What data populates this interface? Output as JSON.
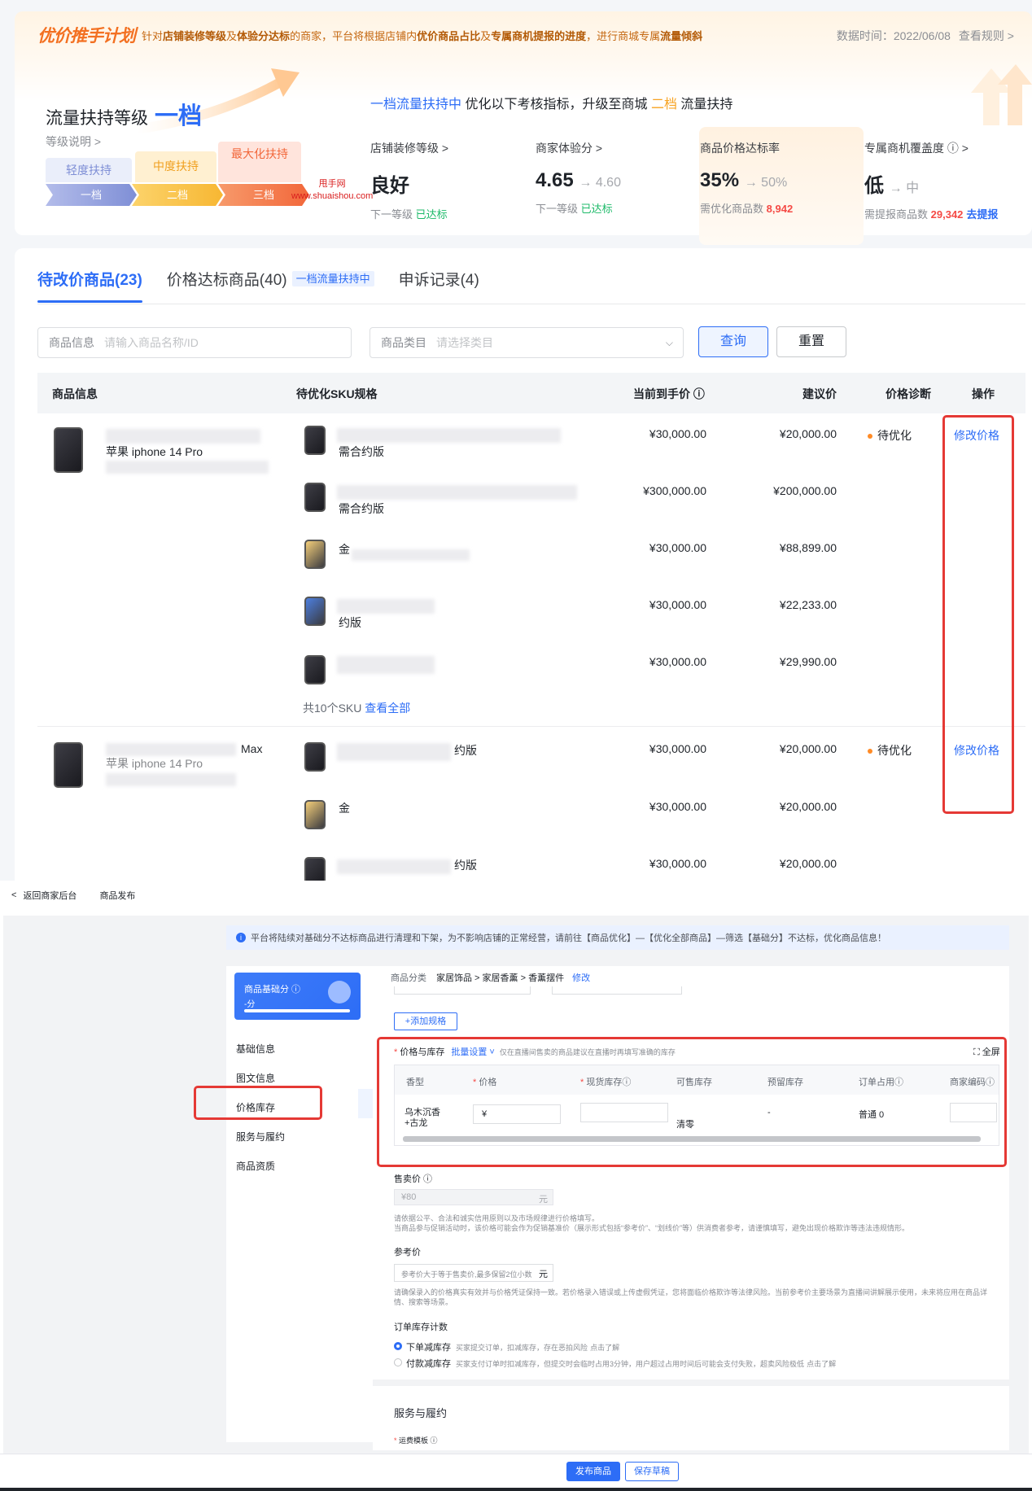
{
  "banner": {
    "logo": "优价推手计划",
    "desc_parts": [
      "针对",
      "店铺装修等级",
      "及",
      "体验分达标",
      "的商家，平台将根据店铺内",
      "优价商品占比",
      "及",
      "专属商机提报的进度",
      "，进行商城专属",
      "流量倾斜"
    ],
    "data_time": "数据时间：2022/06/08",
    "rules_link": "查看规则 >"
  },
  "level": {
    "title": "流量扶持等级",
    "current": "一档",
    "explain": "等级说明 >",
    "tiers": [
      {
        "top": "轻度扶持",
        "label": "一档",
        "color": "#7f8fd6"
      },
      {
        "top": "中度扶持",
        "label": "二档",
        "color": "#f7b733"
      },
      {
        "top": "最大化扶持",
        "label": "三档",
        "color": "#f2673a"
      }
    ],
    "watermark_line1": "甩手网",
    "watermark_line2": "www.shuaishou.com"
  },
  "upgrade": {
    "status": "一档流量扶持中",
    "text": "优化以下考核指标，升级至商城",
    "target": "二档",
    "suffix": "流量扶持"
  },
  "metrics": [
    {
      "label": "店铺装修等级 >",
      "value": "良好",
      "sub": "",
      "foot_prefix": "下一等级",
      "foot_value": "已达标",
      "foot_link": ""
    },
    {
      "label": "商家体验分 >",
      "value": "4.65",
      "sub": "→ 4.60",
      "foot_prefix": "下一等级",
      "foot_value": "已达标",
      "foot_link": ""
    },
    {
      "label": "商品价格达标率",
      "value": "35%",
      "sub": "→ 50%",
      "foot_prefix": "需优化商品数",
      "foot_value": "8,942",
      "foot_link": ""
    },
    {
      "label": "专属商机覆盖度 ⓘ >",
      "value": "低",
      "sub": "→ 中",
      "foot_prefix": "需提报商品数",
      "foot_value": "29,342",
      "foot_link": "去提报"
    }
  ],
  "tabs": [
    {
      "label": "待改价商品(23)",
      "badge": ""
    },
    {
      "label": "价格达标商品(40)",
      "badge": "一档流量扶持中"
    },
    {
      "label": "申诉记录(4)",
      "badge": ""
    }
  ],
  "filters": {
    "product_label": "商品信息",
    "product_placeholder": "请输入商品名称/ID",
    "category_label": "商品类目",
    "category_placeholder": "请选择类目",
    "query": "查询",
    "reset": "重置"
  },
  "table": {
    "headers": [
      "商品信息",
      "待优化SKU规格",
      "当前到手价 ⓘ",
      "建议价",
      "价格诊断",
      "操作"
    ],
    "products": [
      {
        "name": "苹果 iphone 14 Pro",
        "diagnosis": "待优化",
        "action": "修改价格",
        "skus": [
          {
            "spec": "需合约版",
            "current": "¥30,000.00",
            "suggest": "¥20,000.00"
          },
          {
            "spec": "需合约版",
            "current": "¥300,000.00",
            "suggest": "¥200,000.00"
          },
          {
            "spec": "金",
            "current": "¥30,000.00",
            "suggest": "¥88,899.00"
          },
          {
            "spec": "约版",
            "current": "¥30,000.00",
            "suggest": "¥22,233.00"
          },
          {
            "spec": "",
            "current": "¥30,000.00",
            "suggest": "¥29,990.00"
          }
        ],
        "sku_total": "共10个SKU",
        "sku_all": "查看全部"
      },
      {
        "name": "苹果 iphone 14 Pro",
        "name_suffix": "Max",
        "diagnosis": "待优化",
        "action": "修改价格",
        "skus": [
          {
            "spec": "约版",
            "current": "¥30,000.00",
            "suggest": "¥20,000.00"
          },
          {
            "spec": "金",
            "current": "¥30,000.00",
            "suggest": "¥20,000.00"
          },
          {
            "spec": "约版",
            "current": "¥30,000.00",
            "suggest": "¥20,000.00"
          }
        ]
      }
    ]
  },
  "publish": {
    "back": "返回商家后台",
    "page": "商品发布",
    "notice": "平台将陆续对基础分不达标商品进行清理和下架，为不影响店铺的正常经营，请前往【商品优化】—【优化全部商品】—筛选【基础分】不达标，优化商品信息！",
    "score_title": "商品基础分 ⓘ",
    "score_value": "-分",
    "nav": [
      "基础信息",
      "图文信息",
      "价格库存",
      "服务与履约",
      "商品资质"
    ],
    "category_label": "商品分类",
    "category_path": "家居饰品 > 家居香薰 > 香薰摆件",
    "category_edit": "修改",
    "add_spec": "+添加规格",
    "stock_title": "价格与库存",
    "batch": "批量设置 ˅",
    "stock_hint": "仅在直播间售卖的商品建议在直播时再填写准确的库存",
    "fullscreen": "全屏",
    "grid_headers": [
      "香型",
      "价格",
      "现货库存ⓘ",
      "可售库存",
      "预留库存",
      "订单占用ⓘ",
      "商家编码ⓘ"
    ],
    "grid_row": {
      "scent": "乌木沉香+古龙",
      "price_prefix": "¥",
      "clear": "清零",
      "reserve": "-",
      "occupy": "普通 0"
    },
    "sell_price_label": "售卖价 ⓘ",
    "sell_price_value": "¥80",
    "sell_price_unit": "元",
    "sell_hint1": "请依据公平、合法和诚实信用原则以及市场规律进行价格填写。",
    "sell_hint2": "当商品参与促销活动时，该价格可能会作为促销基准价（展示形式包括“参考价”、“划线价”等）供消费者参考，请谨慎填写，避免出现价格欺诈等违法违规情形。",
    "ref_label": "参考价",
    "ref_placeholder": "参考价大于等于售卖价,最多保留2位小数",
    "ref_unit": "元",
    "ref_hint": "请确保录入的价格真实有效并与价格凭证保持一致。若价格录入错误或上传虚假凭证，您将面临价格欺诈等法律风险。当前参考价主要场景为直播间讲解展示使用，未来将应用在商品详情、搜索等场景。",
    "deduct_label": "订单库存计数",
    "deduct_opt1": "下单减库存",
    "deduct_opt1_desc": "买家提交订单，扣减库存，存在恶拍风险",
    "deduct_opt2": "付款减库存",
    "deduct_opt2_desc": "买家支付订单时扣减库存，但提交时会临时占用3分钟，用户超过占用时间后可能会支付失败，超卖风险极低",
    "learn_more": "点击了解",
    "service_title": "服务与履约",
    "shipping_label": "运费模板 ⓘ",
    "btn_publish": "发布商品",
    "btn_draft": "保存草稿"
  }
}
